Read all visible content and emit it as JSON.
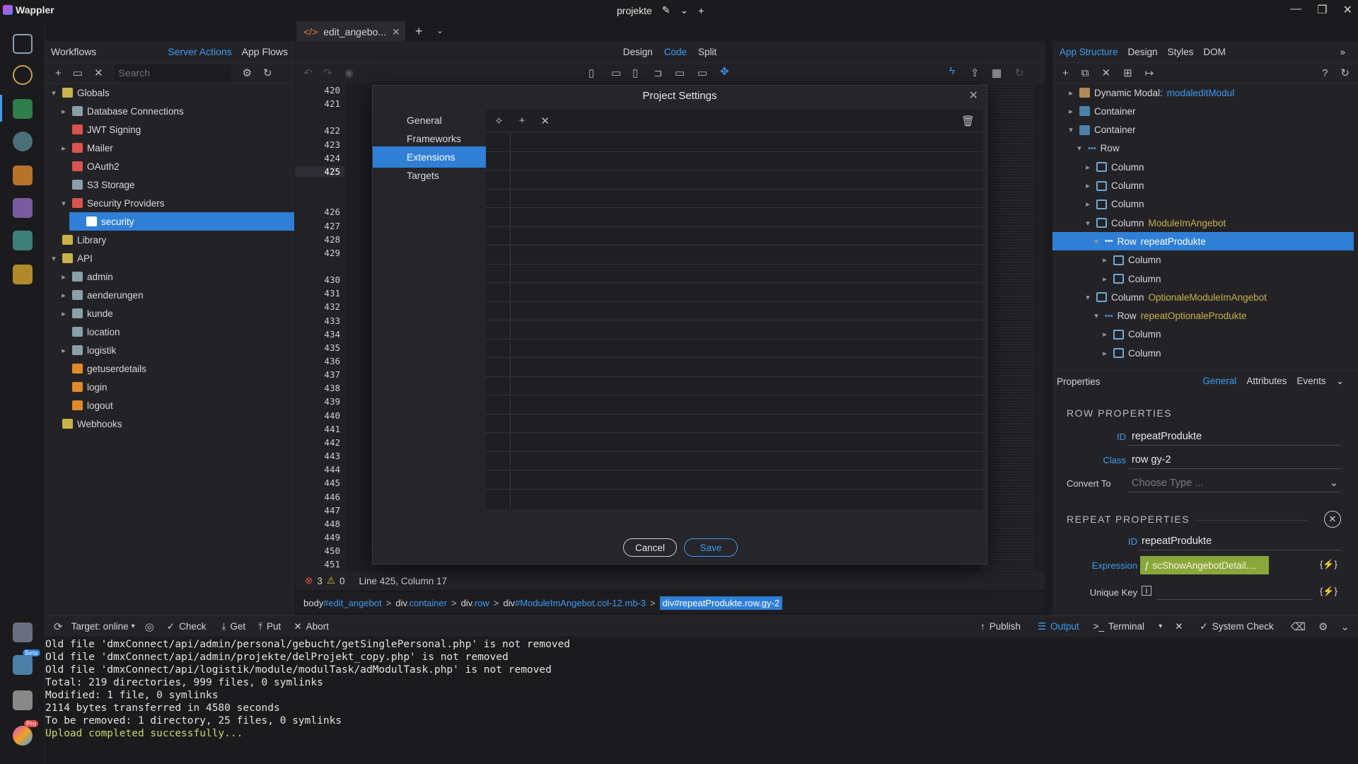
{
  "app": {
    "name": "Wappler",
    "project": "projekte"
  },
  "window_controls": [
    "—",
    "❐",
    "✕"
  ],
  "workflows": {
    "title": "Workflows",
    "tabs": [
      "Server Actions",
      "App Flows"
    ],
    "search_placeholder": "Search",
    "tree": [
      {
        "label": "Globals",
        "level": 0,
        "chevron": "open",
        "color": "#c9b24a"
      },
      {
        "label": "Database Connections",
        "level": 1,
        "chevron": "closed",
        "color": "#8aa0a8"
      },
      {
        "label": "JWT Signing",
        "level": 1,
        "chevron": "",
        "color": "#d9534f"
      },
      {
        "label": "Mailer",
        "level": 1,
        "chevron": "closed",
        "color": "#d9534f"
      },
      {
        "label": "OAuth2",
        "level": 1,
        "chevron": "",
        "color": "#d9534f"
      },
      {
        "label": "S3 Storage",
        "level": 1,
        "chevron": "",
        "color": "#8aa0a8"
      },
      {
        "label": "Security Providers",
        "level": 1,
        "chevron": "open",
        "color": "#d9534f"
      },
      {
        "label": "security",
        "level": 2,
        "chevron": "",
        "color": "#ffffff",
        "selected": true
      },
      {
        "label": "Library",
        "level": 0,
        "chevron": "",
        "color": "#c9b24a"
      },
      {
        "label": "API",
        "level": 0,
        "chevron": "open",
        "color": "#c9b24a"
      },
      {
        "label": "admin",
        "level": 1,
        "chevron": "closed",
        "color": "#8aa0a8"
      },
      {
        "label": "aenderungen",
        "level": 1,
        "chevron": "closed",
        "color": "#8aa0a8"
      },
      {
        "label": "kunde",
        "level": 1,
        "chevron": "closed",
        "color": "#8aa0a8"
      },
      {
        "label": "location",
        "level": 1,
        "chevron": "",
        "color": "#8aa0a8"
      },
      {
        "label": "logistik",
        "level": 1,
        "chevron": "closed",
        "color": "#8aa0a8"
      },
      {
        "label": "getuserdetails",
        "level": 1,
        "chevron": "",
        "color": "#e08a2a"
      },
      {
        "label": "login",
        "level": 1,
        "chevron": "",
        "color": "#e08a2a"
      },
      {
        "label": "logout",
        "level": 1,
        "chevron": "",
        "color": "#e08a2a"
      },
      {
        "label": "Webhooks",
        "level": 0,
        "chevron": "",
        "color": "#c9b24a"
      }
    ]
  },
  "editor": {
    "tab": "edit_angebo...",
    "views": [
      "Design",
      "Code",
      "Split"
    ],
    "active_view": "Code",
    "line_numbers": [
      "420",
      "421",
      "",
      "422",
      "423",
      "424",
      "425",
      "",
      "",
      "426",
      "427",
      "428",
      "429",
      "",
      "430",
      "431",
      "432",
      "433",
      "434",
      "435",
      "436",
      "437",
      "438",
      "439",
      "440",
      "441",
      "442",
      "443",
      "444",
      "445",
      "446",
      "447",
      "448",
      "449",
      "450",
      "451"
    ],
    "status": {
      "errors": "3",
      "warnings": "0",
      "position": "Line 425, Column 17"
    },
    "breadcrumb": [
      {
        "tag": "body",
        "rest": "#edit_angebot"
      },
      {
        "tag": "div",
        "rest": ".container"
      },
      {
        "tag": "div",
        "rest": ".row"
      },
      {
        "tag": "div",
        "rest": "#ModuleImAngebot.col-12.mb-3"
      },
      {
        "tag": "div",
        "rest": "#repeatProdukte.row.gy-2",
        "active": true
      }
    ]
  },
  "modal": {
    "title": "Project Settings",
    "nav": [
      "General",
      "Frameworks",
      "Extensions",
      "Targets"
    ],
    "active_nav": "Extensions",
    "cancel": "Cancel",
    "save": "Save"
  },
  "app_structure": {
    "tabs": [
      "App Structure",
      "Design",
      "Styles",
      "DOM"
    ],
    "tree": [
      {
        "label": "Dynamic Modal:",
        "name": "modaleditModul",
        "level": 1,
        "chevron": "closed",
        "icon": "modal"
      },
      {
        "label": "Container",
        "name": "",
        "level": 1,
        "chevron": "closed",
        "icon": "box"
      },
      {
        "label": "Container",
        "name": "",
        "level": 1,
        "chevron": "open",
        "icon": "box"
      },
      {
        "label": "Row",
        "name": "",
        "level": 2,
        "chevron": "open",
        "icon": "row"
      },
      {
        "label": "Column",
        "name": "",
        "level": 3,
        "chevron": "closed",
        "icon": "col"
      },
      {
        "label": "Column",
        "name": "",
        "level": 3,
        "chevron": "closed",
        "icon": "col"
      },
      {
        "label": "Column",
        "name": "",
        "level": 3,
        "chevron": "closed",
        "icon": "col"
      },
      {
        "label": "Column",
        "name": "ModuleImAngebot",
        "level": 3,
        "chevron": "open",
        "icon": "col"
      },
      {
        "label": "Row",
        "name": "repeatProdukte",
        "level": 4,
        "chevron": "open",
        "icon": "row",
        "selected": true
      },
      {
        "label": "Column",
        "name": "",
        "level": 5,
        "chevron": "closed",
        "icon": "col"
      },
      {
        "label": "Column",
        "name": "",
        "level": 5,
        "chevron": "closed",
        "icon": "col"
      },
      {
        "label": "Column",
        "name": "OptionaleModuleImAngebot",
        "level": 3,
        "chevron": "open",
        "icon": "col"
      },
      {
        "label": "Row",
        "name": "repeatOptionaleProdukte",
        "level": 4,
        "chevron": "open",
        "icon": "row"
      },
      {
        "label": "Column",
        "name": "",
        "level": 5,
        "chevron": "closed",
        "icon": "col"
      },
      {
        "label": "Column",
        "name": "",
        "level": 5,
        "chevron": "closed",
        "icon": "col"
      }
    ]
  },
  "properties": {
    "title": "Properties",
    "tabs": [
      "General",
      "Attributes",
      "Events"
    ],
    "row_section": "ROW PROPERTIES",
    "id_label": "ID",
    "id_value": "repeatProdukte",
    "class_label": "Class",
    "class_value": "row gy-2",
    "convert_label": "Convert To",
    "convert_placeholder": "Choose Type ...",
    "repeat_section": "REPEAT PROPERTIES",
    "repeat_id_label": "ID",
    "repeat_id_value": "repeatProdukte",
    "expression_label": "Expression",
    "expression_value": "scShowAngebotDetail....",
    "unique_key_label": "Unique Key"
  },
  "bottom_toolbar": {
    "target": "Target: online",
    "check": "Check",
    "get": "Get",
    "put": "Put",
    "abort": "Abort",
    "publish": "Publish",
    "output": "Output",
    "terminal": "Terminal",
    "system_check": "System Check"
  },
  "terminal_lines": [
    {
      "text": "Old file 'dmxConnect/api/admin/personal/gebucht/getSinglePersonal.php' is not removed",
      "color": "#e4e4e4"
    },
    {
      "text": "Old file 'dmxConnect/api/admin/projekte/delProjekt_copy.php' is not removed",
      "color": "#e4e4e4"
    },
    {
      "text": "Old file 'dmxConnect/api/logistik/module/modulTask/adModulTask.php' is not removed",
      "color": "#e4e4e4"
    },
    {
      "text": "Total: 219 directories, 999 files, 0 symlinks",
      "color": "#e4e4e4"
    },
    {
      "text": "Modified: 1 file, 0 symlinks",
      "color": "#e4e4e4"
    },
    {
      "text": "2114 bytes transferred in 4580 seconds",
      "color": "#e4e4e4"
    },
    {
      "text": "To be removed: 1 directory, 25 files, 0 symlinks",
      "color": "#e4e4e4"
    },
    {
      "text": "Upload completed successfully...",
      "color": "#c8d86a"
    }
  ],
  "badges": {
    "beta": "Beta",
    "pro": "Pro"
  }
}
